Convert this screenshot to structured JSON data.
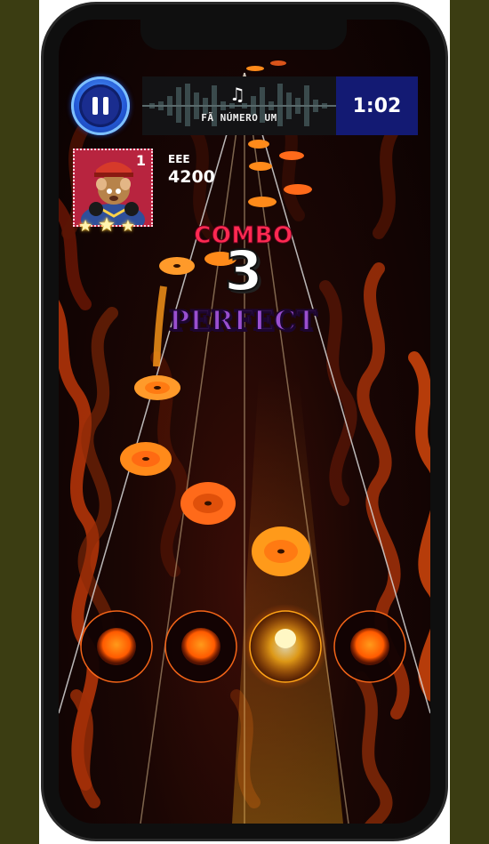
{
  "game": {
    "pause_icon": "pause-icon",
    "song_title": "FÃ NÚMERO UM",
    "music_icon": "music-note-icon",
    "timer": "1:02",
    "player": {
      "rank": "1",
      "name": "EEE",
      "score": "4200",
      "stars": 3,
      "avatar_icon": "rapper-rat-avatar-icon"
    },
    "combo_label": "COMBO",
    "combo_value": "3",
    "judgement": "PERFECT",
    "lanes": 4,
    "colors": {
      "note_orange": "#ff8a1a",
      "lane_glow": "#ff6a00",
      "pause_blue": "#2358d6",
      "timer_bg": "#131a73",
      "combo_red": "#ff2a52",
      "perfect_purple": "#9a4fd0"
    }
  }
}
